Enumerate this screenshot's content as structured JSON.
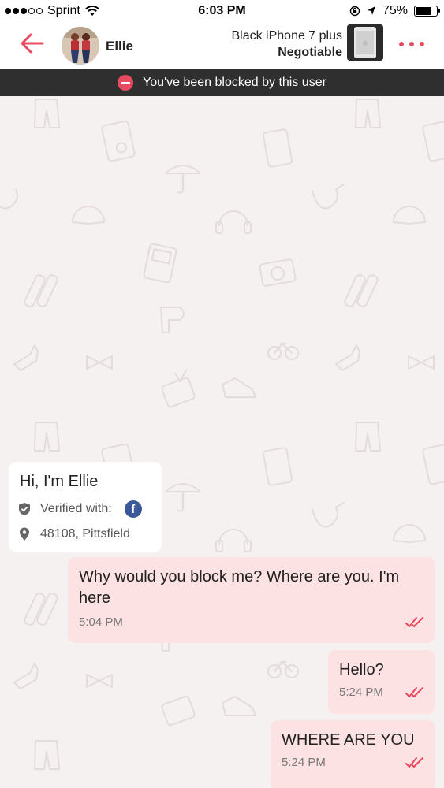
{
  "status_bar": {
    "carrier": "Sprint",
    "time": "6:03 PM",
    "battery": "75%",
    "battery_level": 0.75
  },
  "header": {
    "user_name": "Ellie",
    "listing_title": "Black iPhone 7 plus",
    "listing_price": "Negotiable"
  },
  "banner": {
    "text": "You've been blocked by this user"
  },
  "profile_card": {
    "greeting": "Hi, I'm Ellie",
    "verified_label": "Verified with:",
    "location": "48108, Pittsfield"
  },
  "messages": [
    {
      "text": "Why would you block me? Where are you. I'm here",
      "time": "5:04 PM"
    },
    {
      "text": "Hello?",
      "time": "5:24 PM"
    },
    {
      "text": "WHERE ARE YOU",
      "time": "5:24 PM"
    }
  ],
  "colors": {
    "accent": "#e84b5f",
    "banner_bg": "#2f2f2f",
    "chat_bg": "#f6f1f1",
    "outgoing_bubble": "#fde2e3",
    "facebook": "#3b5998"
  },
  "icons": [
    "back-arrow-icon",
    "more-dots-icon",
    "no-entry-icon",
    "shield-check-icon",
    "facebook-icon",
    "location-pin-icon",
    "double-check-icon"
  ]
}
